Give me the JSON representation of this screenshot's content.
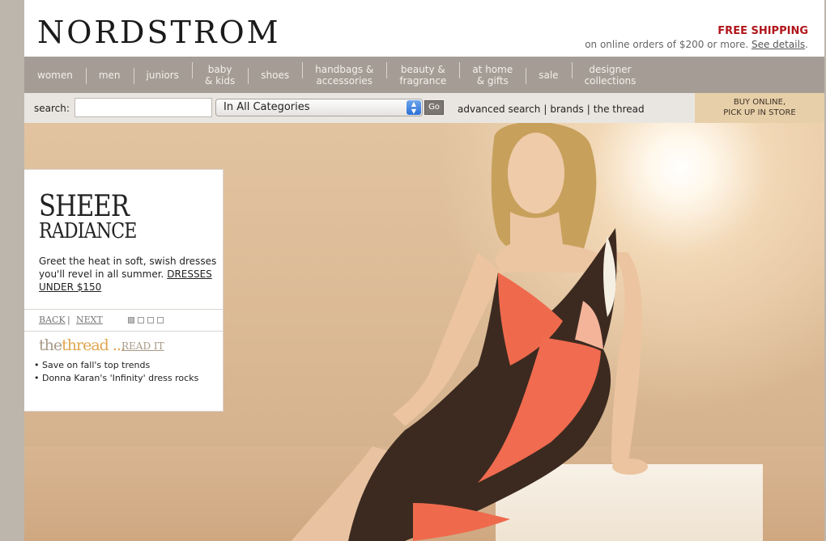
{
  "header": {
    "logo": "NORDSTROM",
    "shipping_title": "FREE SHIPPING",
    "shipping_note": "on online orders of $200 or more.",
    "shipping_link": "See details"
  },
  "nav": [
    {
      "line1": "women",
      "line2": ""
    },
    {
      "line1": "men",
      "line2": ""
    },
    {
      "line1": "juniors",
      "line2": ""
    },
    {
      "line1": "baby",
      "line2": "& kids"
    },
    {
      "line1": "shoes",
      "line2": ""
    },
    {
      "line1": "handbags &",
      "line2": "accessories"
    },
    {
      "line1": "beauty &",
      "line2": "fragrance"
    },
    {
      "line1": "at home",
      "line2": "& gifts"
    },
    {
      "line1": "sale",
      "line2": ""
    },
    {
      "line1": "designer",
      "line2": "collections"
    }
  ],
  "search": {
    "label": "search:",
    "value": "",
    "category": "In All Categories",
    "go_label": "Go",
    "links": [
      "advanced search",
      "brands",
      "the thread"
    ],
    "store_promo_line1": "BUY ONLINE,",
    "store_promo_line2": "PICK UP IN STORE"
  },
  "promo": {
    "title": "SHEER",
    "subtitle": "RADIANCE",
    "text": "Greet the heat in soft, swish dresses you'll revel in all summer.",
    "link": "DRESSES UNDER $150",
    "back": "BACK",
    "separator": "|",
    "next": "NEXT",
    "thread_part1": "the",
    "thread_part2": "thread",
    "thread_ellipsis": " ...",
    "read_it": "READ IT",
    "thread_items": [
      "• Save on fall's top trends",
      "• Donna Karan's 'Infinity' dress rocks"
    ]
  },
  "colors": {
    "accent_red": "#b0161b",
    "nav_bg": "#a59d95",
    "hero_bg": "#dab894"
  }
}
